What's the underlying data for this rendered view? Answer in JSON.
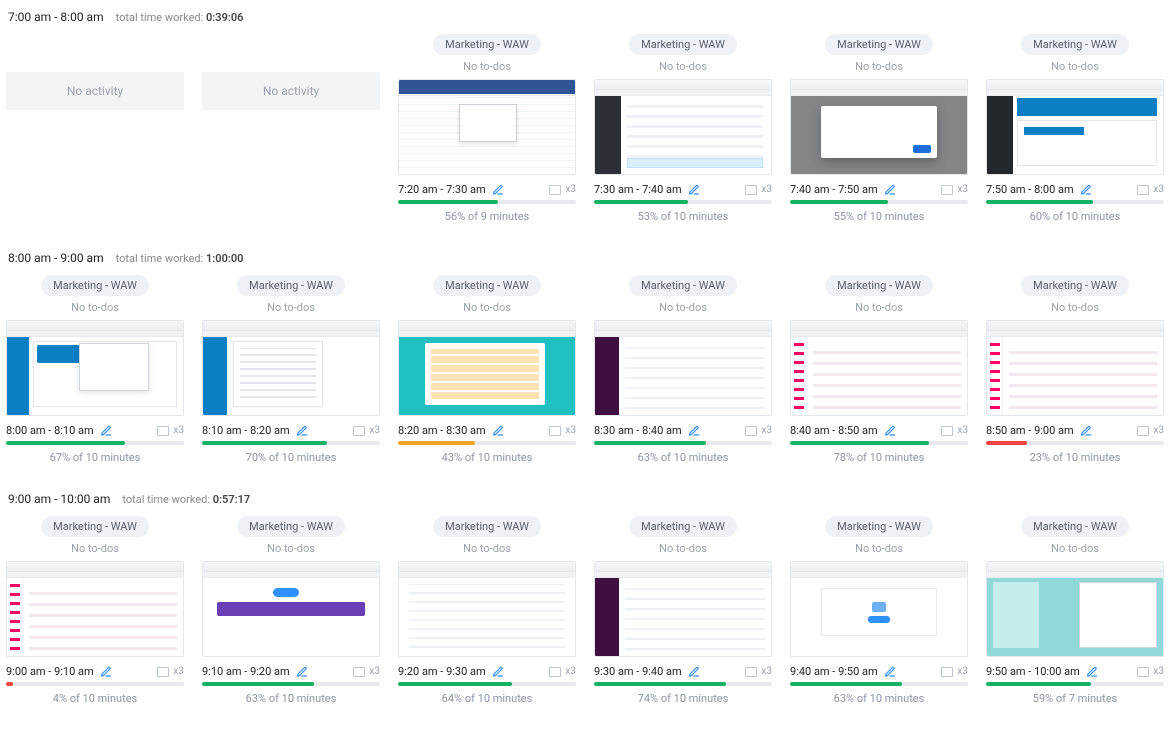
{
  "labels": {
    "no_activity": "No activity",
    "no_todos": "No to-dos",
    "total_prefix": "total time worked: ",
    "screens_prefix": "x"
  },
  "hours": [
    {
      "range": "7:00 am - 8:00 am",
      "total": "0:39:06",
      "slots": [
        {
          "kind": "empty"
        },
        {
          "kind": "empty"
        },
        {
          "kind": "card",
          "project": "Marketing - WAW",
          "time": "7:20 am - 7:30 am",
          "screens": 3,
          "pct": 56,
          "pct_text": "56% of 9 minutes",
          "mock": "excel"
        },
        {
          "kind": "card",
          "project": "Marketing - WAW",
          "time": "7:30 am - 7:40 am",
          "screens": 3,
          "pct": 53,
          "pct_text": "53% of 10 minutes",
          "mock": "darkband"
        },
        {
          "kind": "card",
          "project": "Marketing - WAW",
          "time": "7:40 am - 7:50 am",
          "screens": 3,
          "pct": 55,
          "pct_text": "55% of 10 minutes",
          "mock": "modal"
        },
        {
          "kind": "card",
          "project": "Marketing - WAW",
          "time": "7:50 am - 8:00 am",
          "screens": 3,
          "pct": 60,
          "pct_text": "60% of 10 minutes",
          "mock": "wp"
        }
      ]
    },
    {
      "range": "8:00 am - 9:00 am",
      "total": "1:00:00",
      "slots": [
        {
          "kind": "card",
          "project": "Marketing - WAW",
          "time": "8:00 am - 8:10 am",
          "screens": 3,
          "pct": 67,
          "pct_text": "67% of 10 minutes",
          "mock": "wp2"
        },
        {
          "kind": "card",
          "project": "Marketing - WAW",
          "time": "8:10 am - 8:20 am",
          "screens": 3,
          "pct": 70,
          "pct_text": "70% of 10 minutes",
          "mock": "doc"
        },
        {
          "kind": "card",
          "project": "Marketing - WAW",
          "time": "8:20 am - 8:30 am",
          "screens": 3,
          "pct": 43,
          "pct_text": "43% of 10 minutes",
          "mock": "teal"
        },
        {
          "kind": "card",
          "project": "Marketing - WAW",
          "time": "8:30 am - 8:40 am",
          "screens": 3,
          "pct": 63,
          "pct_text": "63% of 10 minutes",
          "mock": "slack"
        },
        {
          "kind": "card",
          "project": "Marketing - WAW",
          "time": "8:40 am - 8:50 am",
          "screens": 3,
          "pct": 78,
          "pct_text": "78% of 10 minutes",
          "mock": "slack2"
        },
        {
          "kind": "card",
          "project": "Marketing - WAW",
          "time": "8:50 am - 9:00 am",
          "screens": 3,
          "pct": 23,
          "pct_text": "23% of 10 minutes",
          "mock": "slack2"
        }
      ]
    },
    {
      "range": "9:00 am - 10:00 am",
      "total": "0:57:17",
      "slots": [
        {
          "kind": "card",
          "project": "Marketing - WAW",
          "time": "9:00 am - 9:10 am",
          "screens": 3,
          "pct": 4,
          "pct_text": "4% of 10 minutes",
          "mock": "slack2"
        },
        {
          "kind": "card",
          "project": "Marketing - WAW",
          "time": "9:10 am - 9:20 am",
          "screens": 3,
          "pct": 63,
          "pct_text": "63% of 10 minutes",
          "mock": "purple"
        },
        {
          "kind": "card",
          "project": "Marketing - WAW",
          "time": "9:20 am - 9:30 am",
          "screens": 3,
          "pct": 64,
          "pct_text": "64% of 10 minutes",
          "mock": "plain"
        },
        {
          "kind": "card",
          "project": "Marketing - WAW",
          "time": "9:30 am - 9:40 am",
          "screens": 3,
          "pct": 74,
          "pct_text": "74% of 10 minutes",
          "mock": "slack"
        },
        {
          "kind": "card",
          "project": "Marketing - WAW",
          "time": "9:40 am - 9:50 am",
          "screens": 3,
          "pct": 63,
          "pct_text": "63% of 10 minutes",
          "mock": "privacy"
        },
        {
          "kind": "card",
          "project": "Marketing - WAW",
          "time": "9:50 am - 10:00 am",
          "screens": 3,
          "pct": 59,
          "pct_text": "59% of 7 minutes",
          "mock": "tealchat"
        }
      ]
    }
  ]
}
